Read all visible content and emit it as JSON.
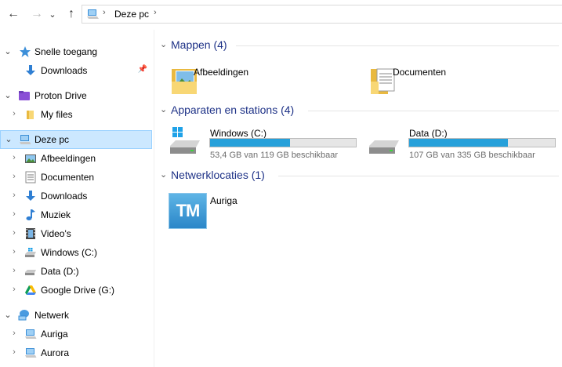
{
  "address": {
    "crumb": "Deze pc",
    "separator": "›"
  },
  "nav": {
    "back": "←",
    "forward": "→",
    "recent": "⌄",
    "up": "↑"
  },
  "sidebar": {
    "items": [
      {
        "label": "Snelle toegang",
        "chevron": "⌄",
        "icon": "star-icon"
      },
      {
        "label": "Downloads",
        "icon": "download-icon",
        "pin": "📌"
      },
      {
        "label": "Proton Drive",
        "chevron": "⌄",
        "icon": "proton-drive-icon"
      },
      {
        "label": "My files",
        "chevron": "›",
        "icon": "folder-icon"
      },
      {
        "label": "Deze pc",
        "chevron": "⌄",
        "icon": "computer-icon"
      },
      {
        "label": "Afbeeldingen",
        "chevron": "›",
        "icon": "pictures-icon"
      },
      {
        "label": "Documenten",
        "chevron": "›",
        "icon": "documents-icon"
      },
      {
        "label": "Downloads",
        "chevron": "›",
        "icon": "download-icon"
      },
      {
        "label": "Muziek",
        "chevron": "›",
        "icon": "music-icon"
      },
      {
        "label": "Video's",
        "chevron": "›",
        "icon": "video-icon"
      },
      {
        "label": "Windows (C:)",
        "chevron": "›",
        "icon": "windows-drive-icon"
      },
      {
        "label": "Data (D:)",
        "chevron": "›",
        "icon": "drive-icon"
      },
      {
        "label": "Google Drive (G:)",
        "chevron": "›",
        "icon": "google-drive-icon"
      },
      {
        "label": "Netwerk",
        "chevron": "⌄",
        "icon": "network-icon"
      },
      {
        "label": "Auriga",
        "chevron": "›",
        "icon": "network-computer-icon"
      },
      {
        "label": "Aurora",
        "chevron": "›",
        "icon": "network-computer-icon"
      }
    ]
  },
  "groups": {
    "folders": {
      "title": "Mappen (4)",
      "chevron": "⌄",
      "items": [
        {
          "label": "Afbeeldingen"
        },
        {
          "label": "Documenten"
        }
      ]
    },
    "devices": {
      "title": "Apparaten en stations (4)",
      "chevron": "⌄",
      "items": [
        {
          "label": "Windows (C:)",
          "free": "53,4 GB van 119 GB beschikbaar",
          "used_fraction": 0.55
        },
        {
          "label": "Data (D:)",
          "free": "107 GB van 335 GB beschikbaar",
          "used_fraction": 0.68
        }
      ]
    },
    "network": {
      "title": "Netwerklocaties (1)",
      "chevron": "⌄",
      "items": [
        {
          "label": "Auriga",
          "icon_text": "TM"
        }
      ]
    }
  },
  "colors": {
    "accent": "#1e3287",
    "selection": "#cce8ff",
    "drive_bar": "#26a0da",
    "folder": "#f8d775"
  }
}
